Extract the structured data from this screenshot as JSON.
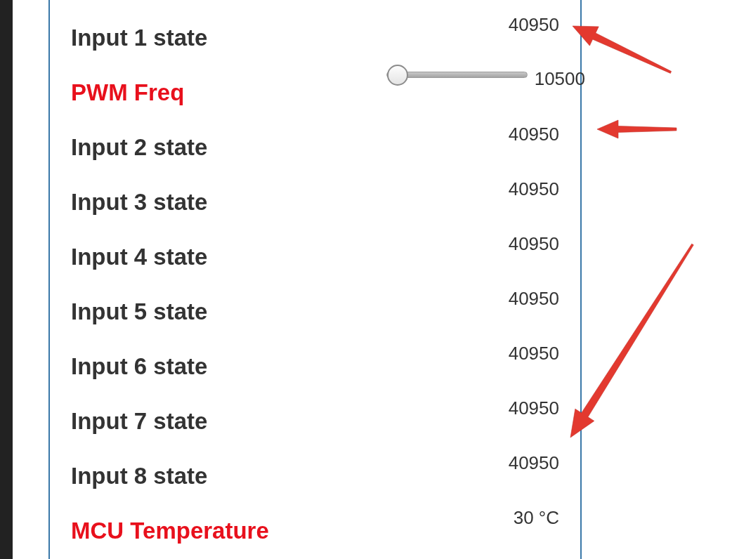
{
  "rows": [
    {
      "kind": "reading",
      "label": "Input 1 state",
      "color": "#333333",
      "value": "40950"
    },
    {
      "kind": "slider",
      "label": "PWM Freq",
      "color": "#e8101c",
      "value": "10500",
      "level": 0
    },
    {
      "kind": "reading",
      "label": "Input 2 state",
      "color": "#333333",
      "value": "40950"
    },
    {
      "kind": "reading",
      "label": "Input 3 state",
      "color": "#333333",
      "value": "40950"
    },
    {
      "kind": "reading",
      "label": "Input 4 state",
      "color": "#333333",
      "value": "40950"
    },
    {
      "kind": "reading",
      "label": "Input 5 state",
      "color": "#333333",
      "value": "40950"
    },
    {
      "kind": "reading",
      "label": "Input 6 state",
      "color": "#333333",
      "value": "40950"
    },
    {
      "kind": "reading",
      "label": "Input 7 state",
      "color": "#333333",
      "value": "40950"
    },
    {
      "kind": "reading",
      "label": "Input 8 state",
      "color": "#333333",
      "value": "40950"
    },
    {
      "kind": "reading",
      "label": "MCU Temperature",
      "color": "#e8101c",
      "value": "30 °C"
    }
  ]
}
